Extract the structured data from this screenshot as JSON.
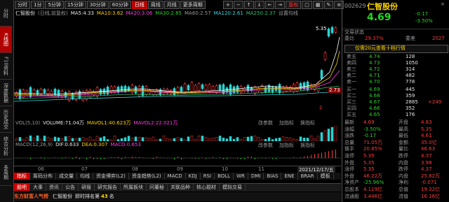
{
  "toolbar": {
    "buttons": [
      "分时",
      "1分",
      "5分钟",
      "15分钟",
      "30分钟",
      "60分钟",
      "日线",
      "周线",
      "月线",
      "更多周期"
    ],
    "active_index": 6,
    "right_icons": [
      "复权"
    ]
  },
  "left_tabs": [
    "分时",
    "K线图",
    "F10资料",
    "深度数据",
    "历史成交",
    "综合分析",
    "多周期"
  ],
  "left_active_index": 1,
  "ma_legend": {
    "title": "仁智股份",
    "mode": "(日线,前复权)",
    "ma5": "MA5:4.33",
    "ma10": "MA10:3.62",
    "ma20": "MA20:3.06",
    "ma30": "MA30:2.85",
    "ma60": "MA60:2.57",
    "ma120": "MA120:2.61",
    "ma250": "MA250:2.37",
    "settings": "设置均线"
  },
  "price_labels": {
    "high": "5.35",
    "low": "2",
    "ref": "2.73"
  },
  "vol_legend": {
    "label": "VOL(5,10)",
    "volume": "VOLUME:71.04万",
    "mavol1": "MAVOL1:40.623万",
    "mavol2": "MAVOL2:22.021万",
    "change_params": "改参数",
    "add_indicator": "加指标",
    "template": "换指标"
  },
  "macd_legend": {
    "label": "MACD(12,26,9)",
    "dif": "DIF:0.633",
    "dea": "DEA:0.307",
    "macd": "MACD:0.653",
    "change_params": "改参数",
    "add_indicator": "加指标",
    "template": "换指标"
  },
  "x_axis": [
    "06",
    "07",
    "08",
    "09",
    "10",
    "11"
  ],
  "date_label": "2021/12/17/五",
  "indicator_tabs": [
    "指标",
    "筹码分布",
    "成交量",
    "均线",
    "资金博弈(L2)",
    "资金趋势(L2)",
    "MACD",
    "KDJ",
    "RSI",
    "BOLL",
    "WR",
    "DMI",
    "BIAS",
    "ENE",
    "BRAR",
    "模板"
  ],
  "indicator_active": 0,
  "news_tabs": [
    "股吧",
    "大事",
    "资讯",
    "公告",
    "研报",
    "研究报告",
    "所属板块",
    "问董秘",
    "关联品种",
    "核心题材",
    "模拟交易"
  ],
  "news_active": 0,
  "bottom_banner": {
    "brand": "东方财富人气榜",
    "stock": "仁智股份",
    "rank_label": "即时排名第",
    "rank": "43",
    "unit": "名"
  },
  "quote": {
    "code": "002629",
    "name": "仁智股份",
    "price": "4.69",
    "change": "-0.17",
    "change_pct": "-3.50%",
    "labels": {
      "status": "交易状态",
      "committee_ratio": "委比",
      "committee_diff": "委差",
      "committee_ratio_val": "29.37%",
      "committee_diff_val": "2027",
      "ad": "仅需20元查看十档行情"
    },
    "asks": [
      {
        "label": "卖五",
        "price": "4.74",
        "vol": "128"
      },
      {
        "label": "卖四",
        "price": "4.73",
        "vol": "1050"
      },
      {
        "label": "卖三",
        "price": "4.72",
        "vol": "314"
      },
      {
        "label": "卖二",
        "price": "4.71",
        "vol": "482"
      },
      {
        "label": "卖一",
        "price": "4.70",
        "vol": "778"
      }
    ],
    "bids": [
      {
        "label": "买一",
        "price": "4.69",
        "vol": "445"
      },
      {
        "label": "买二",
        "price": "4.68",
        "vol": "359"
      },
      {
        "label": "买三",
        "price": "4.67",
        "vol": "2885",
        "chg": "+249"
      },
      {
        "label": "买四",
        "price": "4.66",
        "vol": "352"
      },
      {
        "label": "买五",
        "price": "4.65",
        "vol": "176"
      }
    ],
    "stats": [
      {
        "l": "最新",
        "v": "4.69",
        "l2": "开盘",
        "v2": "4.83"
      },
      {
        "l": "涨幅",
        "v": "-3.50%",
        "l2": "最高",
        "v2": "5.35"
      },
      {
        "l": "涨跌",
        "v": "-0.17",
        "l2": "最低",
        "v2": "4.61"
      },
      {
        "l": "总量",
        "v": "71.05万",
        "l2": "金额",
        "v2": "35.0亿"
      },
      {
        "l": "换手",
        "v": "20.85%",
        "l2": "量比",
        "v2": "46.63"
      },
      {
        "l": "涨停",
        "v": "5.35",
        "l2": "跌停",
        "v2": "4.37"
      },
      {
        "l": "外盘",
        "v": "5.35",
        "l2": "内盘",
        "v2": "3.98"
      },
      {
        "l": "涨停",
        "v": "5.35",
        "l2": "跌停",
        "v2": "4.37"
      },
      {
        "l": "外盘",
        "v": "46.22万",
        "l2": "内盘",
        "v2": "25.62万"
      },
      {
        "l": "净资产",
        "v": "-25.96%",
        "l2": "净利",
        "v2": "-0.071"
      },
      {
        "l": "总股本",
        "v": "4.119亿",
        "l2": "总值",
        "v2": "19.32亿"
      },
      {
        "l": "流通股",
        "v": "3.446亿",
        "l2": "流值",
        "v2": "16.16亿"
      }
    ]
  }
}
